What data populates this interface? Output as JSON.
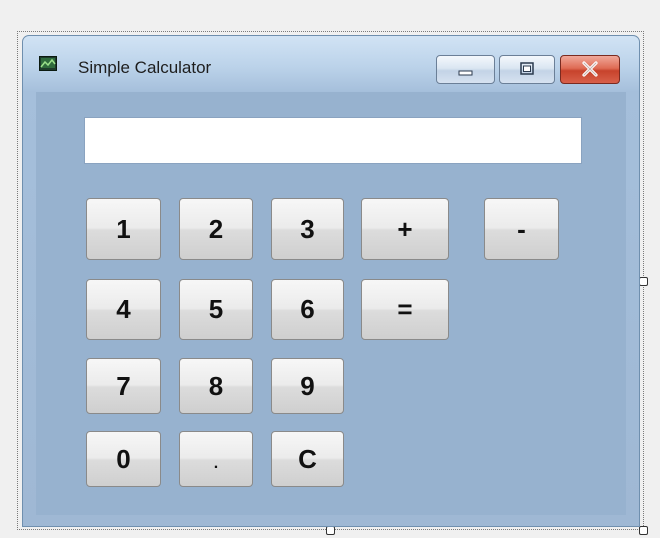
{
  "window": {
    "title": "Simple Calculator",
    "icon": "app-window-icon"
  },
  "caption_buttons": {
    "minimize_icon": "minimize-icon",
    "maximize_icon": "maximize-icon",
    "close_icon": "close-icon"
  },
  "display": {
    "value": ""
  },
  "keys": {
    "k1": "1",
    "k2": "2",
    "k3": "3",
    "plus": "+",
    "minus": "-",
    "k4": "4",
    "k5": "5",
    "k6": "6",
    "equals": "=",
    "k7": "7",
    "k8": "8",
    "k9": "9",
    "k0": "0",
    "dot": ".",
    "clear": "C"
  },
  "colors": {
    "client_background": "#97b2cf",
    "close_button": "#c7432c"
  }
}
